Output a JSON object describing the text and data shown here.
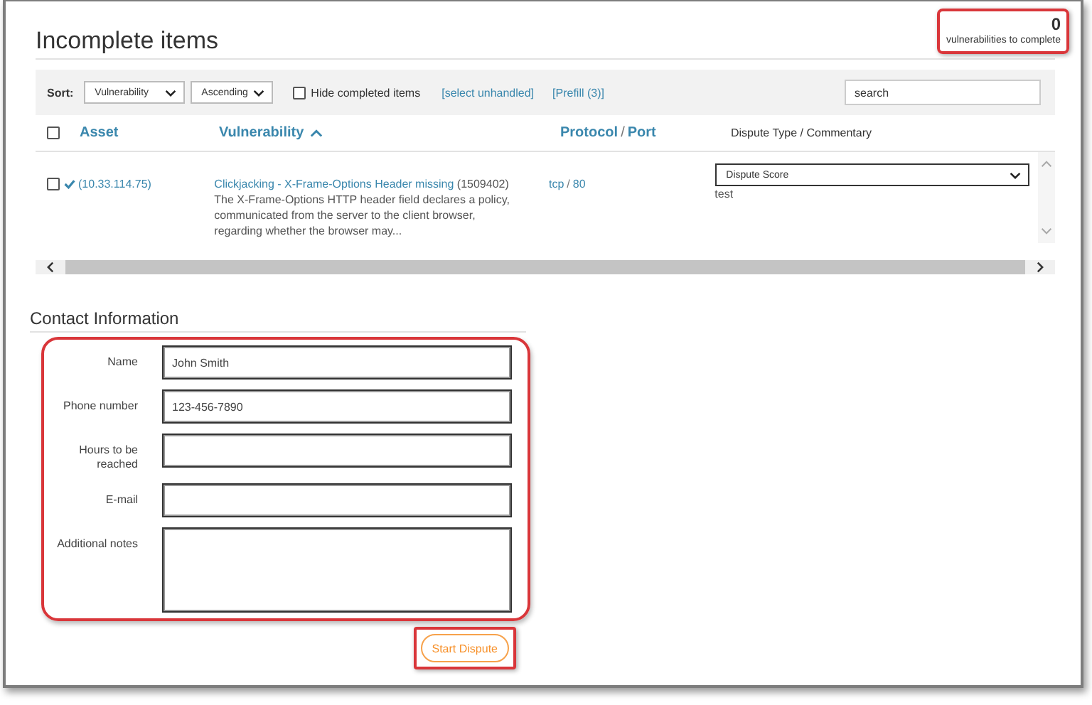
{
  "title": "Incomplete items",
  "counter": {
    "value": "0",
    "label": "vulnerabilities to complete",
    "highlighted": true
  },
  "toolbar": {
    "sort_label": "Sort:",
    "sort_field": "Vulnerability",
    "sort_order": "Ascending",
    "hide_completed": {
      "label": "Hide completed items",
      "checked": false
    },
    "links": [
      "[select unhandled]",
      "[Prefill (3)]"
    ],
    "search": {
      "placeholder": "search"
    }
  },
  "table": {
    "select_all": {
      "checked": false
    },
    "columns": [
      {
        "kind": "link",
        "label": "Asset",
        "sorted": false
      },
      {
        "kind": "link",
        "label": "Vulnerability",
        "sorted": true
      },
      {
        "kind": "pair",
        "parts": [
          "Protocol",
          "Port"
        ],
        "separator": "/"
      },
      {
        "kind": "plain",
        "label": "Dispute Type / Commentary"
      }
    ],
    "rows": [
      {
        "checked": false,
        "complete": true,
        "asset": "(10.33.114.75)",
        "vulnerability": "Clickjacking - X-Frame-Options Header missing",
        "vuln_id": "(1509402)",
        "description": "The X-Frame-Options HTTP header field declares a policy, communicated from the server to the client browser, regarding whether the browser may...",
        "protocol": "tcp",
        "separator": "/",
        "port": "80",
        "dispute_type": "Dispute Score",
        "commentary": "test"
      }
    ]
  },
  "contact": {
    "title": "Contact Information",
    "highlighted": true,
    "fields": [
      {
        "kind": "input",
        "label": "Name",
        "value": "John Smith"
      },
      {
        "kind": "input",
        "label": "Phone number",
        "value": "123-456-7890"
      },
      {
        "kind": "input",
        "label": "Hours to be reached"
      },
      {
        "kind": "input",
        "label": "E-mail"
      },
      {
        "kind": "textarea",
        "label": "Additional notes"
      }
    ]
  },
  "submit": {
    "label": "Start Dispute",
    "highlighted": true
  }
}
